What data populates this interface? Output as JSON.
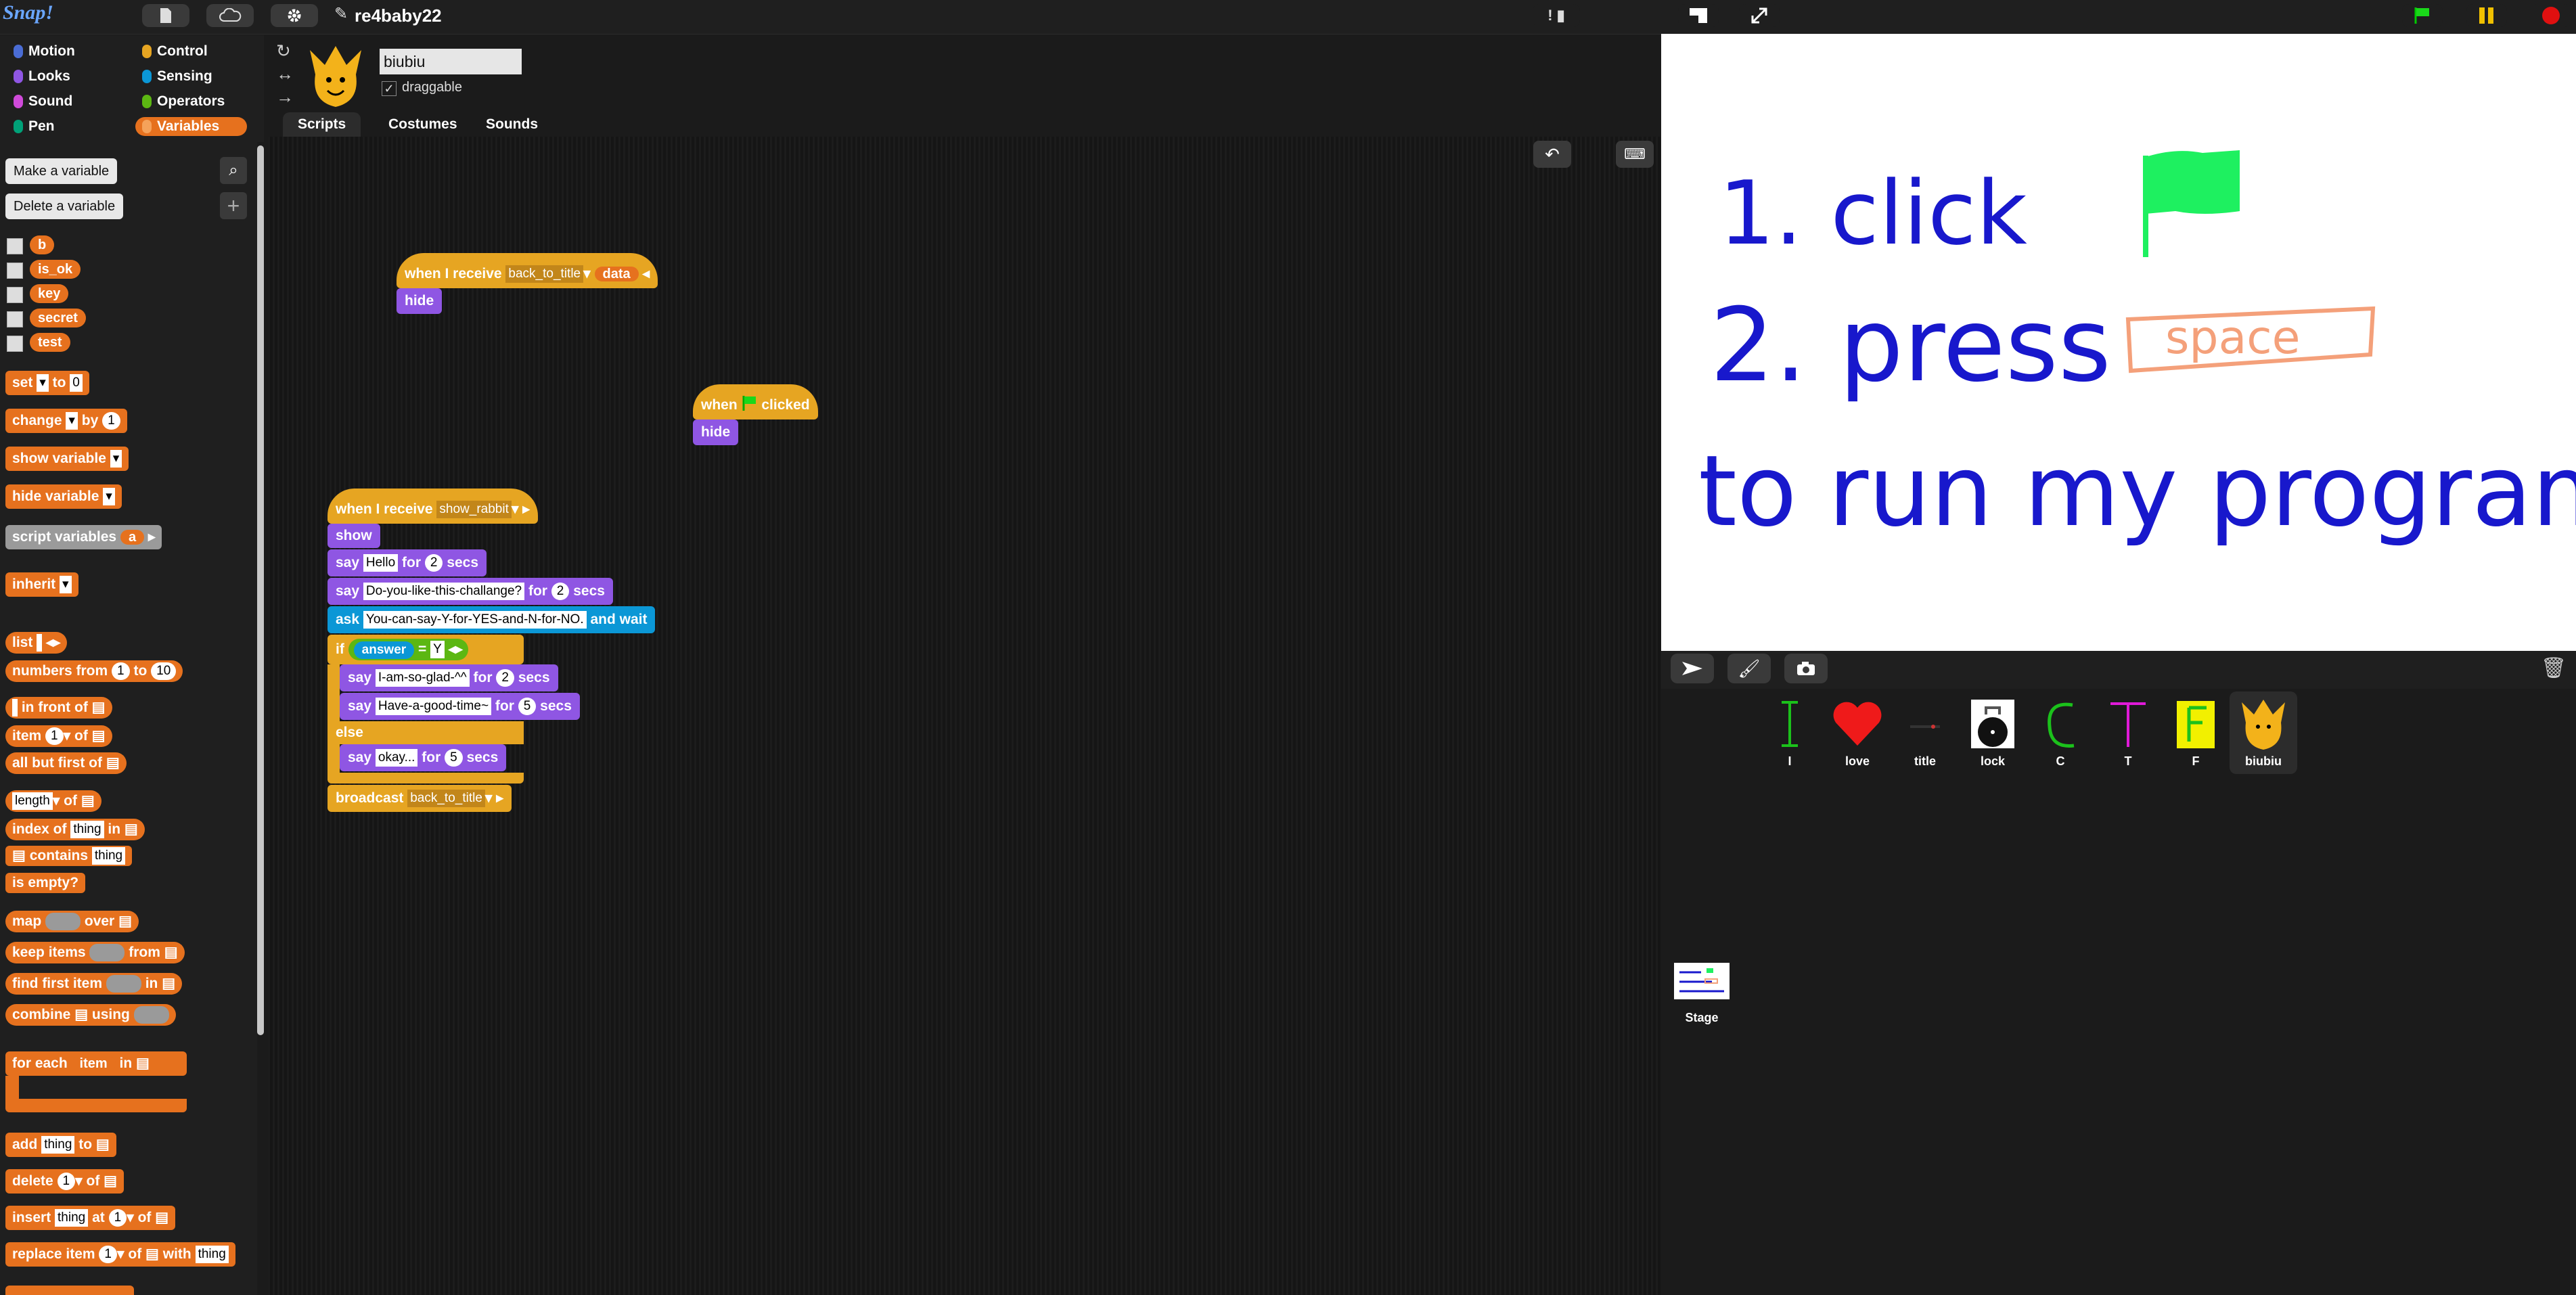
{
  "topbar": {
    "logo": "Snap!",
    "project_name": "re4baby22"
  },
  "categories": [
    {
      "label": "Motion",
      "color": "#4a6cd4"
    },
    {
      "label": "Control",
      "color": "#e6a522"
    },
    {
      "label": "Looks",
      "color": "#8f56e3"
    },
    {
      "label": "Sensing",
      "color": "#0b97d6"
    },
    {
      "label": "Sound",
      "color": "#cf4ad9"
    },
    {
      "label": "Operators",
      "color": "#5cb712"
    },
    {
      "label": "Pen",
      "color": "#00a178"
    },
    {
      "label": "Variables",
      "color": "#e6711e"
    }
  ],
  "palette": {
    "make_variable": "Make a variable",
    "delete_variable": "Delete a variable",
    "variables": [
      "b",
      "is_ok",
      "key",
      "secret",
      "test"
    ],
    "set": {
      "label": "set",
      "to": "to",
      "value": "0"
    },
    "change": {
      "label": "change",
      "by": "by",
      "value": "1"
    },
    "show_variable": "show variable",
    "hide_variable": "hide variable",
    "script_variables": {
      "label": "script variables",
      "arg": "a"
    },
    "inherit": "inherit",
    "list": "list",
    "numbers_from": {
      "label": "numbers from",
      "from": "1",
      "to_label": "to",
      "to": "10"
    },
    "in_front_of": "in front of",
    "item_of": {
      "label": "item",
      "value": "1",
      "of": "of"
    },
    "all_but_first": "all but first of",
    "length_of": {
      "dropdown": "length",
      "of": "of"
    },
    "index_of": {
      "label": "index of",
      "thing": "thing",
      "in": "in"
    },
    "contains": {
      "label": "contains",
      "thing": "thing"
    },
    "is_empty": "is  empty?",
    "map": {
      "label": "map",
      "over": "over"
    },
    "keep_items": {
      "label": "keep items",
      "from": "from"
    },
    "find_first": {
      "label": "find first item",
      "in": "in"
    },
    "combine": {
      "label": "combine",
      "using": "using"
    },
    "for_each": {
      "label": "for each",
      "item": "item",
      "in": "in"
    },
    "add": {
      "label": "add",
      "thing": "thing",
      "to": "to"
    },
    "delete": {
      "label": "delete",
      "value": "1",
      "of": "of"
    },
    "insert": {
      "label": "insert",
      "thing": "thing",
      "at": "at",
      "value": "1",
      "of": "of"
    },
    "replace": {
      "label": "replace item",
      "value": "1",
      "of": "of",
      "with": "with",
      "thing": "thing"
    }
  },
  "sprite": {
    "name": "biubiu",
    "draggable_label": "draggable",
    "tabs": [
      "Scripts",
      "Costumes",
      "Sounds"
    ]
  },
  "scripts": {
    "s1": {
      "when_receive": "when I receive",
      "message": "back_to_title",
      "data": "data",
      "hide": "hide"
    },
    "s2": {
      "when": "when",
      "clicked": "clicked",
      "hide": "hide"
    },
    "s3": {
      "when_receive": "when I receive",
      "message": "show_rabbit",
      "show": "show",
      "say1": {
        "say": "say",
        "text": "Hello",
        "for": "for",
        "n": "2",
        "secs": "secs"
      },
      "say2": {
        "say": "say",
        "text": "Do-you-like-this-challange?",
        "for": "for",
        "n": "2",
        "secs": "secs"
      },
      "ask": {
        "ask": "ask",
        "text": "You-can-say-Y-for-YES-and-N-for-NO.",
        "wait": "and wait"
      },
      "if": {
        "if": "if",
        "answer": "answer",
        "eq": "=",
        "value": "Y"
      },
      "say3": {
        "say": "say",
        "text": "I-am-so-glad-^^",
        "for": "for",
        "n": "2",
        "secs": "secs"
      },
      "say4": {
        "say": "say",
        "text": "Have-a-good-time~",
        "for": "for",
        "n": "5",
        "secs": "secs"
      },
      "else": "else",
      "say5": {
        "say": "say",
        "text": "okay...",
        "for": "for",
        "n": "5",
        "secs": "secs"
      },
      "broadcast": {
        "label": "broadcast",
        "message": "back_to_title"
      }
    }
  },
  "stage": {
    "line1": "1. click",
    "line2": "2. press",
    "key": "space",
    "line3": "to run my program"
  },
  "corral": {
    "sprites": [
      {
        "name": "I"
      },
      {
        "name": "love"
      },
      {
        "name": "title"
      },
      {
        "name": "lock"
      },
      {
        "name": "C"
      },
      {
        "name": "T"
      },
      {
        "name": "F"
      },
      {
        "name": "biubiu"
      }
    ],
    "stage_label": "Stage"
  }
}
